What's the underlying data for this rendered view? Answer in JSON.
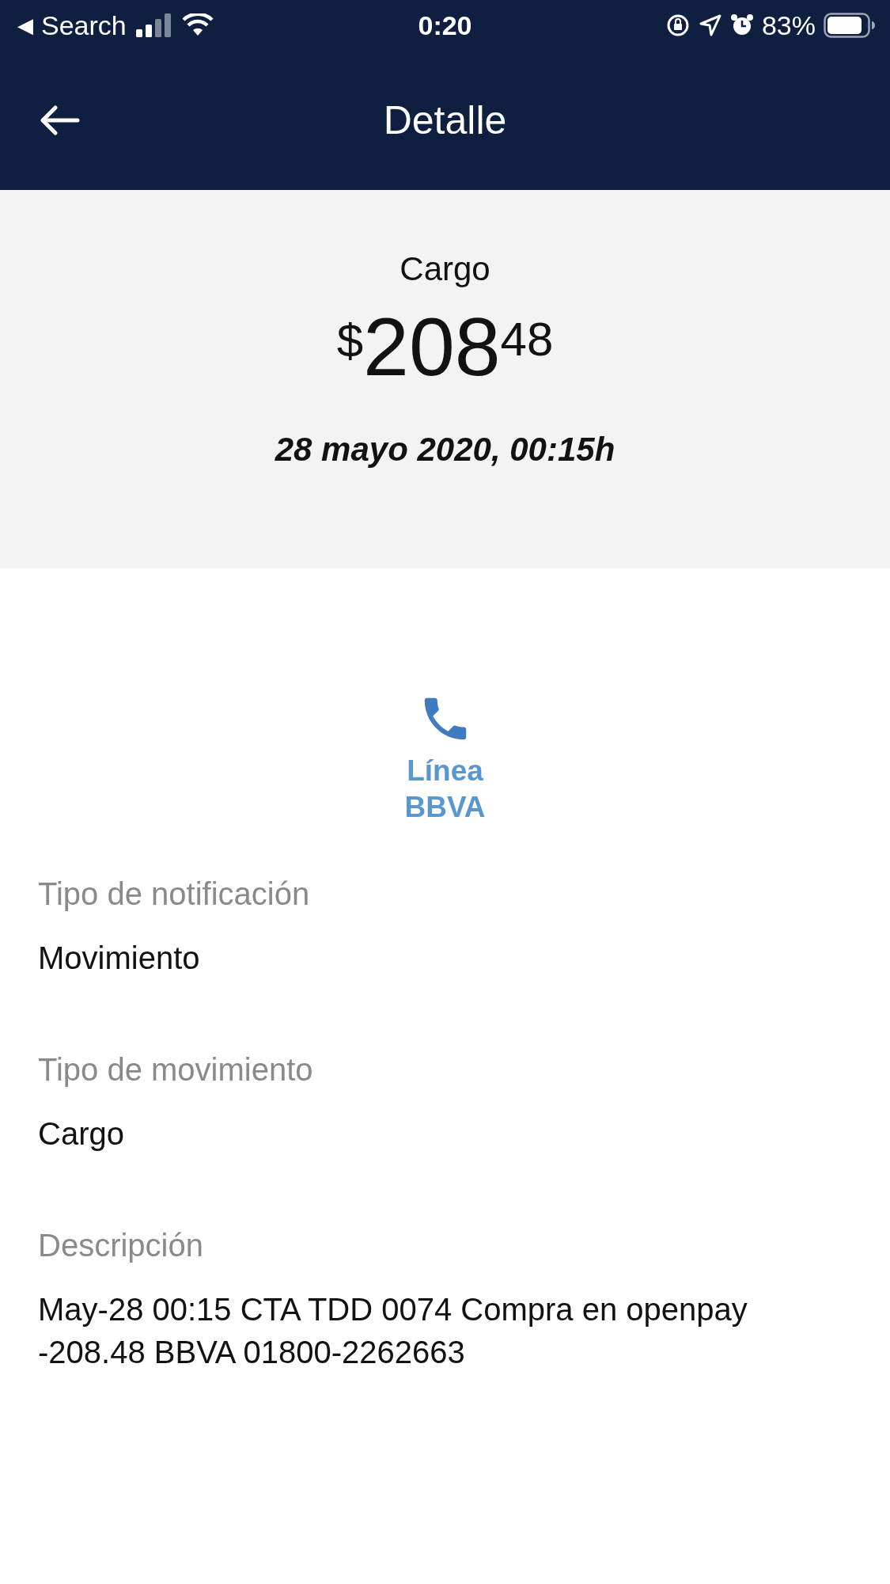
{
  "status_bar": {
    "back_glyph": "◀",
    "back_label": "Search",
    "time": "0:20",
    "battery": "83%"
  },
  "nav": {
    "title": "Detalle"
  },
  "summary": {
    "type": "Cargo",
    "currency": "$",
    "amount": "208",
    "cents": "48",
    "date": "28 mayo 2020, 00:15h"
  },
  "contact": {
    "label": "Línea BBVA"
  },
  "fields": [
    {
      "label": "Tipo de notificación",
      "value": "Movimiento"
    },
    {
      "label": "Tipo de movimiento",
      "value": "Cargo"
    },
    {
      "label": "Descripción",
      "value": "May-28 00:15 CTA TDD 0074 Compra en openpay -208.48 BBVA 01800-2262663"
    }
  ]
}
